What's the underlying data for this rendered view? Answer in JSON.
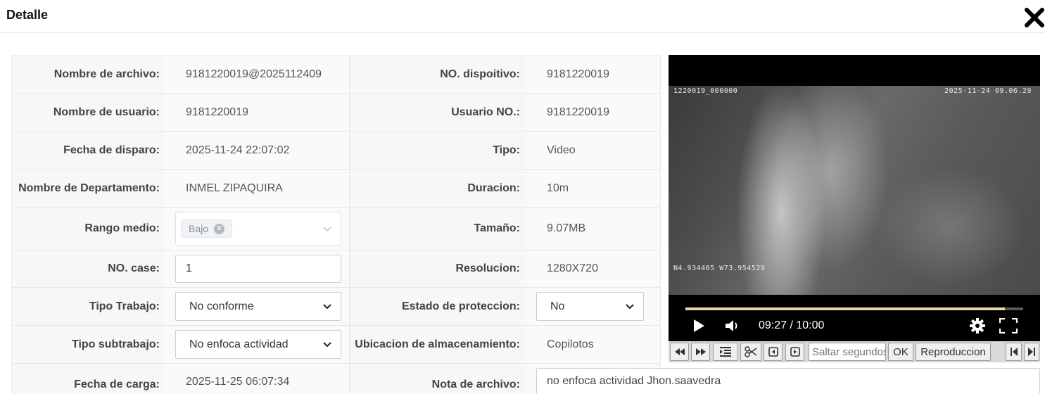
{
  "header": {
    "title": "Detalle"
  },
  "rows": [
    {
      "label1": "Nombre de archivo:",
      "value1": "9181220019@2025112409",
      "label2": "NO. dispoitivo:",
      "value2": "9181220019"
    },
    {
      "label1": "Nombre de usuario:",
      "value1": "9181220019",
      "label2": "Usuario NO.:",
      "value2": "9181220019"
    },
    {
      "label1": "Fecha de disparo:",
      "value1": "2025-11-24 22:07:02",
      "label2": "Tipo:",
      "value2": "Video"
    },
    {
      "label1": "Nombre de Departamento:",
      "value1": "INMEL ZIPAQUIRA",
      "label2": "Duracion:",
      "value2": "10m"
    },
    {
      "label1": "Rango medio:",
      "tag": "Bajo",
      "label2": "Tamaño:",
      "value2": "9.07MB"
    },
    {
      "label1": "NO. case:",
      "input_value": "1",
      "label2": "Resolucion:",
      "value2": "1280X720"
    },
    {
      "label1": "Tipo Trabajo:",
      "select1": "No conforme",
      "label2": "Estado de proteccion:",
      "select2": "No"
    },
    {
      "label1": "Tipo subtrabajo:",
      "select1": "No enfoca actividad",
      "label2": "Ubicacion de almacenamiento:",
      "value2": "Copilotos"
    },
    {
      "label1": "Fecha de carga:",
      "value1": "2025-11-25 06:07:34",
      "label2": "Nota de archivo:",
      "note": "no enfoca actividad Jhon.saavedra"
    }
  ],
  "video": {
    "osd_top_left": "1220019_000000",
    "osd_top_right": "2025-11-24 09.06.29",
    "osd_coords": "N4.934405 W73.954529",
    "time": "09:27 / 10:00",
    "progress": 0.945
  },
  "toolbar": {
    "seek_placeholder": "Saltar segundos",
    "ok_label": "OK",
    "playback_label": "Reproduccion"
  }
}
